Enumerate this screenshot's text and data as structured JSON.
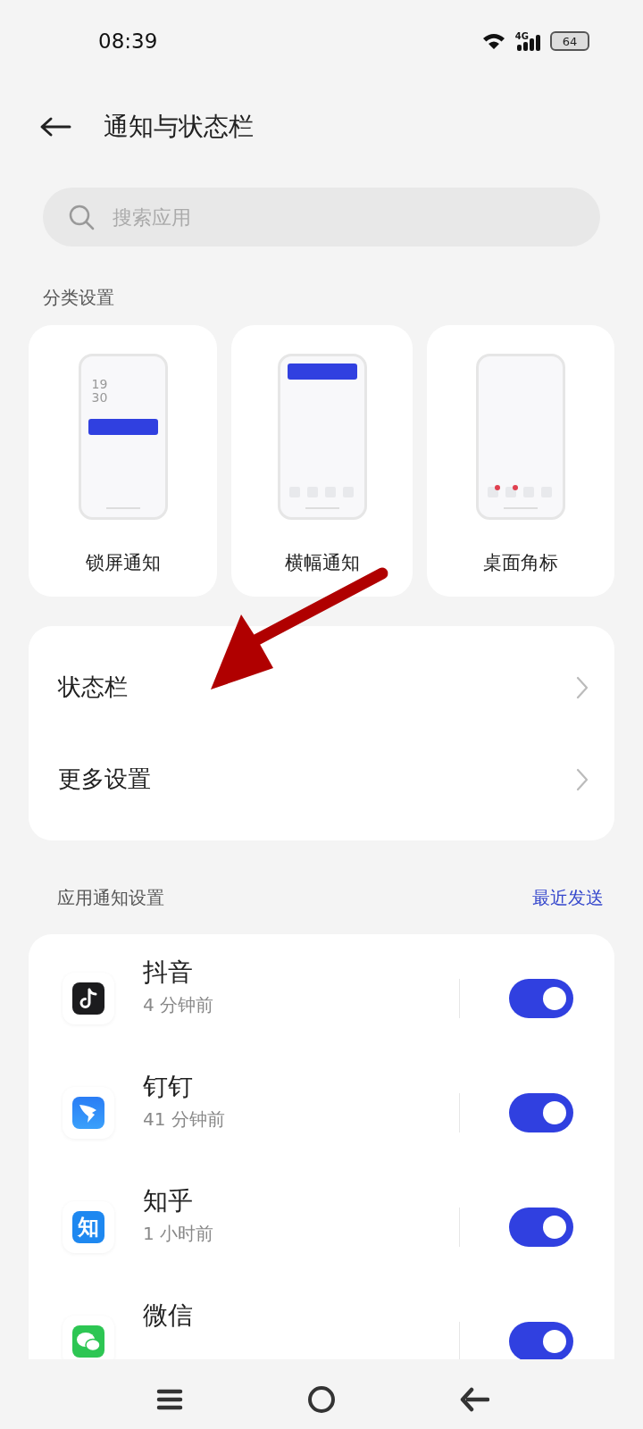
{
  "status_bar": {
    "time": "08:39",
    "network": "4G",
    "battery": "64"
  },
  "header": {
    "title": "通知与状态栏"
  },
  "search": {
    "placeholder": "搜索应用"
  },
  "category_section": {
    "title": "分类设置",
    "cards": [
      {
        "kind": "lockscreen",
        "label": "锁屏通知",
        "clock": [
          "19",
          "30"
        ]
      },
      {
        "kind": "banner",
        "label": "横幅通知"
      },
      {
        "kind": "badge",
        "label": "桌面角标"
      }
    ]
  },
  "menu": [
    {
      "label": "状态栏"
    },
    {
      "label": "更多设置"
    }
  ],
  "apps_section": {
    "title": "应用通知设置",
    "link": "最近发送",
    "apps": [
      {
        "kind": "douyin",
        "name": "抖音",
        "time": "4 分钟前",
        "on": true
      },
      {
        "kind": "dingtalk",
        "name": "钉钉",
        "time": "41 分钟前",
        "on": true
      },
      {
        "kind": "zhihu",
        "name": "知乎",
        "time": "1 小时前",
        "on": true,
        "icon_text": "知"
      },
      {
        "kind": "wechat",
        "name": "微信",
        "on": true
      }
    ]
  }
}
